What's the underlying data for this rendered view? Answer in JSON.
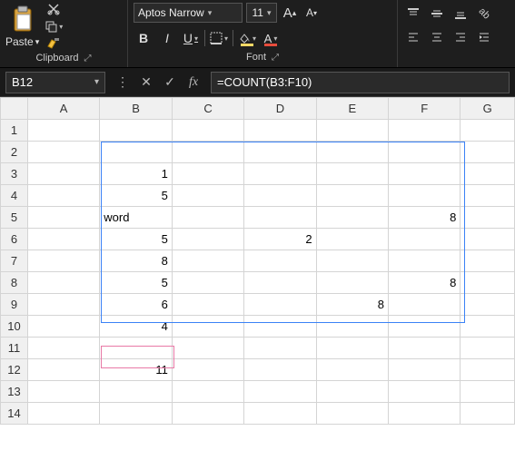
{
  "ribbon": {
    "clipboard": {
      "paste_label": "Paste",
      "group_label": "Clipboard"
    },
    "font": {
      "font_name": "Aptos Narrow",
      "font_size": "11",
      "bold": "B",
      "italic": "I",
      "underline": "U",
      "fill_color": "#ffd966",
      "font_color": "#e74c3c",
      "group_label": "Font"
    }
  },
  "name_box": "B12",
  "formula": "=COUNT(B3:F10)",
  "columns": [
    "A",
    "B",
    "C",
    "D",
    "E",
    "F",
    "G"
  ],
  "rows": [
    "1",
    "2",
    "3",
    "4",
    "5",
    "6",
    "7",
    "8",
    "9",
    "10",
    "11",
    "12",
    "13",
    "14"
  ],
  "cells": {
    "B3": "1",
    "B4": "5",
    "B5_text": "word",
    "F5": "8",
    "B6": "5",
    "D6": "2",
    "B7": "8",
    "B8": "5",
    "F8": "8",
    "B9": "6",
    "E9": "8",
    "B10": "4",
    "B12": "11"
  }
}
